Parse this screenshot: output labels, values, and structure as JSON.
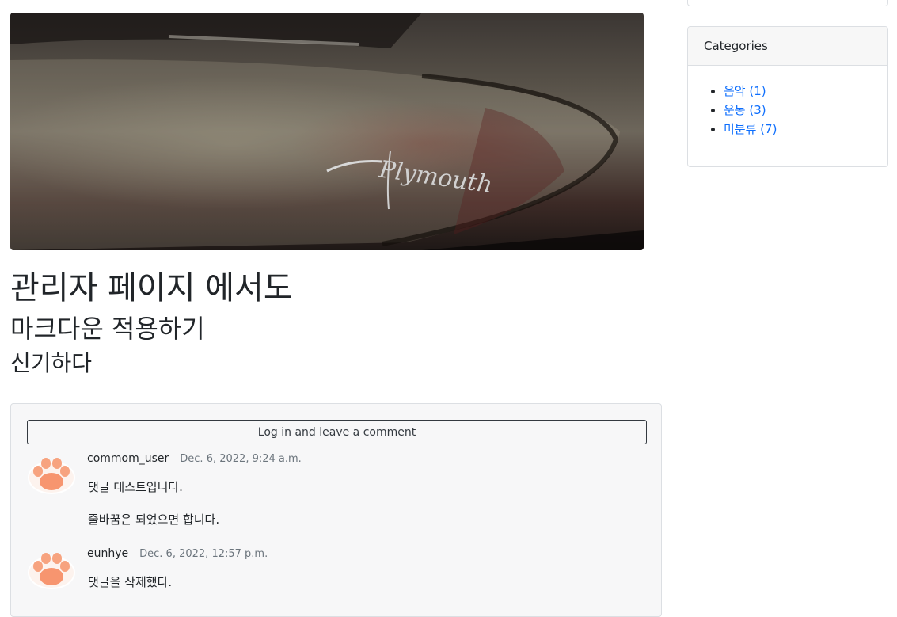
{
  "post": {
    "hero_image_logo_text": "Plymouth",
    "title": "관리자 페이지 에서도",
    "subtitle": "마크다운 적용하기",
    "subheading": "신기하다"
  },
  "comments_section": {
    "login_button_label": "Log in and leave a comment",
    "comments": [
      {
        "author": "commom_user",
        "date": "Dec. 6, 2022, 9:24 a.m.",
        "paragraphs": [
          "댓글 테스트입니다.",
          "줄바꿈은 되었으면 합니다."
        ]
      },
      {
        "author": "eunhye",
        "date": "Dec. 6, 2022, 12:57 p.m.",
        "paragraphs": [
          "댓글을 삭제했다."
        ]
      }
    ]
  },
  "sidebar": {
    "categories": {
      "header": "Categories",
      "items": [
        {
          "label": "음악 (1)"
        },
        {
          "label": "운동 (3)"
        },
        {
          "label": "미분류 (7)"
        }
      ]
    }
  },
  "colors": {
    "link": "#0d6efd",
    "muted_text": "#6c757d",
    "card_border": "#dcdfe3",
    "comment_bg": "#f7f7f8"
  },
  "icons": {
    "avatar": "cat-paw-icon"
  }
}
